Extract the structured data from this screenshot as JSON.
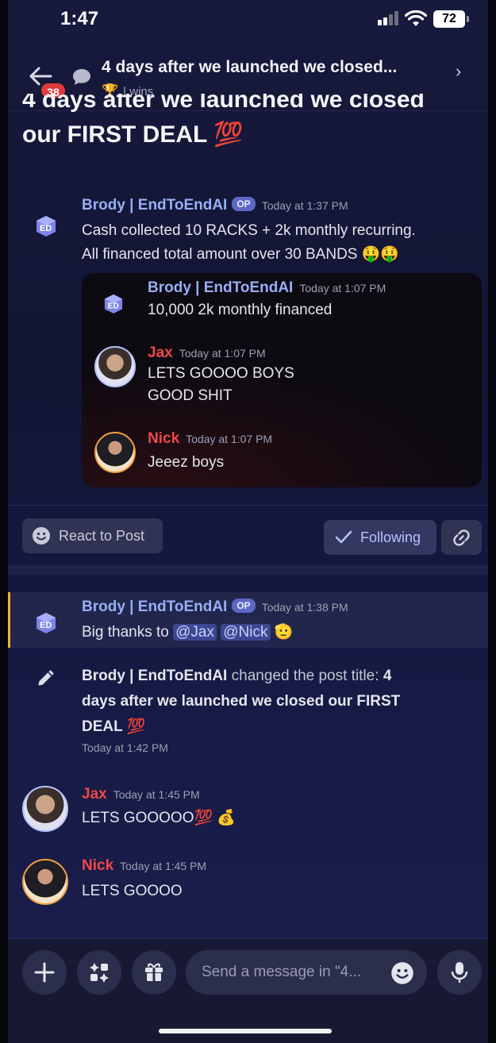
{
  "status": {
    "time": "1:47",
    "battery": "72"
  },
  "header": {
    "badge_count": "38",
    "title": "4 days after we launched we closed...",
    "channel_emoji": "🏆",
    "channel": "| wins"
  },
  "post": {
    "title_line1": "4 days after we launched we closed",
    "title_line2": "our FIRST DEAL 💯"
  },
  "op_message": {
    "author": "Brody | EndToEndAI",
    "op_tag": "OP",
    "time": "Today at 1:37 PM",
    "line1": "Cash collected 10 RACKS + 2k monthly recurring.",
    "line2": "All financed total amount over 30 BANDS 🤑🤑"
  },
  "quoted": [
    {
      "author": "Brody | EndToEndAI",
      "time": "Today at 1:07 PM",
      "lines": [
        "10,000 2k monthly financed"
      ]
    },
    {
      "author": "Jax",
      "time": "Today at 1:07 PM",
      "lines": [
        "LETS GOOOO BOYS",
        "GOOD SHIT"
      ]
    },
    {
      "author": "Nick",
      "time": "Today at 1:07 PM",
      "lines": [
        "Jeeez boys"
      ]
    }
  ],
  "actions": {
    "react": "React to Post",
    "following": "Following"
  },
  "thanks_message": {
    "author": "Brody | EndToEndAI",
    "op_tag": "OP",
    "time": "Today at 1:38 PM",
    "prefix": "Big thanks to ",
    "mention1": "@Jax",
    "mention2": "@Nick",
    "suffix": " 🫡"
  },
  "system_message": {
    "author": "Brody | EndToEndAI",
    "action": " changed the post title: ",
    "new_title_line1": "4",
    "new_title_line2": "days after we launched we closed our FIRST",
    "new_title_line3": "DEAL 💯",
    "time": "Today at 1:42 PM"
  },
  "replies": [
    {
      "author": "Jax",
      "time": "Today at 1:45 PM",
      "text": "LETS GOOOOO💯 💰"
    },
    {
      "author": "Nick",
      "time": "Today at 1:45 PM",
      "text": "LETS GOOOO"
    }
  ],
  "composer": {
    "placeholder": "Send a message in \"4..."
  },
  "colors": {
    "accent_blue": "#98aef7",
    "name_red": "#f04747",
    "op_badge": "#5d68c6",
    "highlight_bar": "#f0b232"
  }
}
